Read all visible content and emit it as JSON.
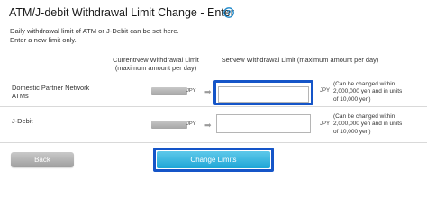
{
  "header": {
    "title": "ATM/J-debit Withdrawal Limit Change - Enter",
    "help_icon": "question-circle-icon"
  },
  "description": {
    "line1": "Daily withdrawal limit of ATM or J-Debit can be set here.",
    "line2": "Enter a new limit only."
  },
  "table": {
    "columns": {
      "current_line1": "CurrentNew Withdrawal Limit",
      "current_line2": "(maximum amount per day)",
      "new_line1": "SetNew Withdrawal Limit (maximum amount per day)"
    },
    "rows": [
      {
        "label_line1": "Domestic Partner Network",
        "label_line2": "ATMs",
        "current_unit": "JPY",
        "new_value": "",
        "new_unit": "JPY",
        "note_line1": "(Can be changed within",
        "note_line2": "2,000,000 yen and in units",
        "note_line3": "of 10,000 yen)"
      },
      {
        "label_line1": "J-Debit",
        "current_unit": "JPY",
        "new_value": "",
        "new_unit": "JPY",
        "note_line1": "(Can be changed within",
        "note_line2": "2,000,000 yen and in units",
        "note_line3": "of 10,000 yen)"
      }
    ]
  },
  "buttons": {
    "back": "Back",
    "change_limits": "Change Limits"
  },
  "colors": {
    "highlight_border": "#1555c8",
    "primary_button": "#1ea6d7",
    "help_icon": "#1e88c9"
  }
}
